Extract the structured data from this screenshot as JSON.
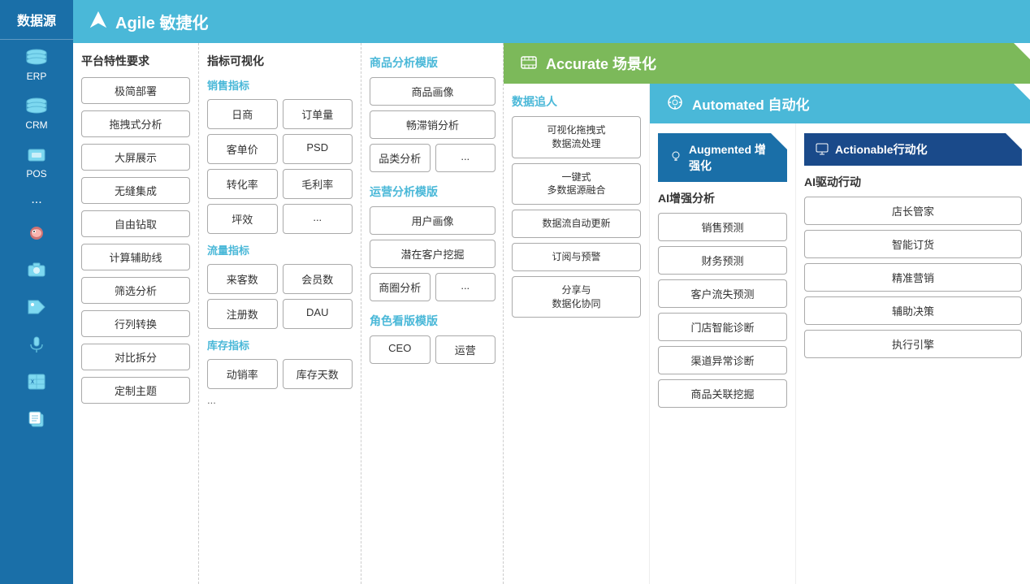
{
  "sidebar": {
    "header": "数据源",
    "items": [
      {
        "label": "ERP",
        "icon": "database-icon"
      },
      {
        "label": "CRM",
        "icon": "database-icon"
      },
      {
        "label": "POS",
        "icon": "database-icon"
      },
      {
        "label": "...",
        "icon": "ellipsis-icon"
      },
      {
        "label": "",
        "icon": "weibo-icon"
      },
      {
        "label": "",
        "icon": "camera-icon"
      },
      {
        "label": "",
        "icon": "tag-icon"
      },
      {
        "label": "",
        "icon": "mic-icon"
      },
      {
        "label": "",
        "icon": "excel-icon"
      },
      {
        "label": "",
        "icon": "copy-icon"
      }
    ]
  },
  "agile": {
    "title": "Agile 敏捷化",
    "icon": "navigation-icon"
  },
  "platform": {
    "title": "平台特性要求",
    "features": [
      "极简部署",
      "拖拽式分析",
      "大屏展示",
      "无缝集成",
      "自由钻取",
      "计算辅助线",
      "筛选分析",
      "行列转换",
      "对比拆分",
      "定制主题"
    ]
  },
  "metrics": {
    "title": "指标可视化",
    "sales": {
      "title": "销售指标",
      "items": [
        "日商",
        "订单量",
        "客单价",
        "PSD",
        "转化率",
        "毛利率",
        "坪效"
      ],
      "dots": "..."
    },
    "traffic": {
      "title": "流量指标",
      "items": [
        "来客数",
        "会员数",
        "注册数",
        "DAU"
      ]
    },
    "inventory": {
      "title": "库存指标",
      "items": [
        "动销率",
        "库存天数"
      ],
      "dots": "..."
    }
  },
  "accurate": {
    "title": "Accurate 场景化",
    "icon": "film-icon"
  },
  "product_module": {
    "title": "商品分析模版",
    "items": [
      "商品画像",
      "畅滞销分析",
      "品类分析"
    ],
    "dots": "..."
  },
  "operation_module": {
    "title": "运营分析模版",
    "items": [
      "用户画像",
      "潜在客户挖掘",
      "商圈分析"
    ],
    "dots": "..."
  },
  "role_module": {
    "title": "角色看版模版",
    "items": [
      "CEO",
      "运营"
    ]
  },
  "automated": {
    "title": "Automated 自动化",
    "icon": "auto-icon"
  },
  "data_tracker": {
    "title": "数据追人",
    "items": [
      "可视化拖拽式\n数据流处理",
      "一键式\n多数据源融合",
      "数据流自动更新",
      "订阅与预警",
      "分享与\n数据化协同"
    ]
  },
  "augmented": {
    "title": "Augmented 增强化",
    "icon": "bulb-icon"
  },
  "ai_analysis": {
    "title": "AI增强分析",
    "items": [
      "销售预测",
      "财务预测",
      "客户流失预测",
      "门店智能诊断",
      "渠道异常诊断",
      "商品关联挖掘"
    ]
  },
  "actionable": {
    "title": "Actionable行动化",
    "icon": "monitor-icon"
  },
  "ai_drive": {
    "title": "AI驱动行动",
    "items": [
      "店长管家",
      "智能订货",
      "精准营销",
      "辅助决策",
      "执行引擎"
    ]
  }
}
